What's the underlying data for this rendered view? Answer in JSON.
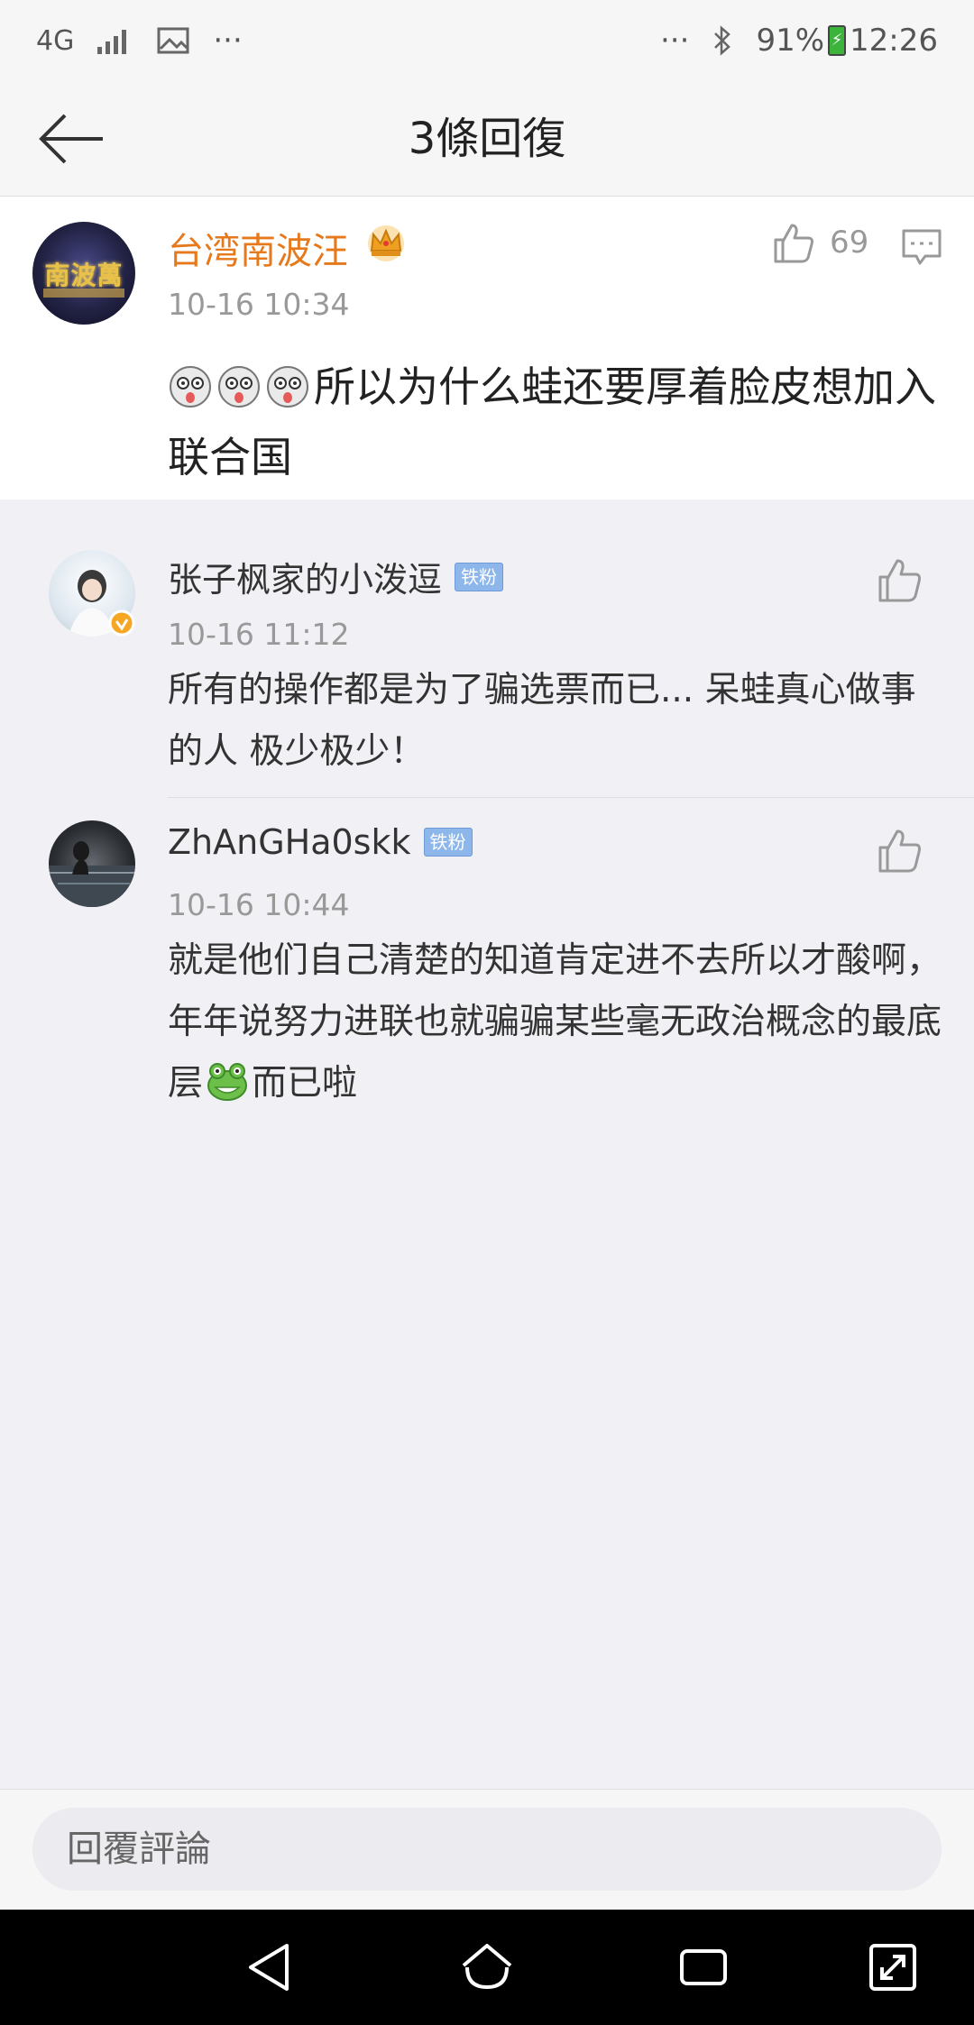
{
  "status_bar": {
    "network": "4G",
    "more": "···",
    "more_right": "···",
    "battery_percent": "91%",
    "time": "12:26"
  },
  "header": {
    "title": "3條回復",
    "back_icon": "arrow-left-icon"
  },
  "main_comment": {
    "author": "台湾南波汪",
    "avatar_text": "南波萬",
    "time": "10-16 10:34",
    "like_count": "69",
    "text": "所以为什么蛙还要厚着脸皮想加入联合国",
    "emoji_count": 3
  },
  "replies": [
    {
      "author": "张子枫家的小泼逗",
      "badge": "铁粉",
      "time": "10-16 11:12",
      "text": "所有的操作都是为了骗选票而已... 呆蛙真心做事的人  极少极少！"
    },
    {
      "author": "ZhAnGHa0skk",
      "badge": "铁粉",
      "time": "10-16 10:44",
      "text_before_emoji": "就是他们自己清楚的知道肯定进不去所以才酸啊，年年说努力进联也就骗骗某些毫无政治概念的最底层",
      "text_after_emoji": "而已啦"
    }
  ],
  "input": {
    "placeholder": "回覆評論"
  },
  "colors": {
    "accent_name": "#e5791c",
    "badge": "#8db6ea",
    "background": "#f1f1f5"
  }
}
